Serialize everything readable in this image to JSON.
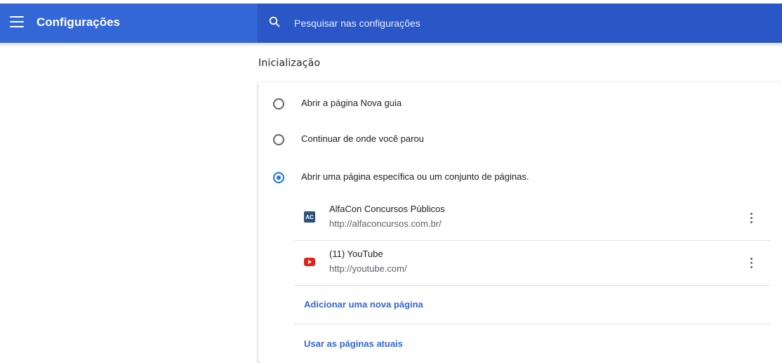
{
  "header": {
    "title": "Configurações",
    "menu_icon": "hamburger-menu-icon",
    "search_icon": "search-icon",
    "search_placeholder": "Pesquisar nas configurações",
    "search_value": "",
    "colors": {
      "toolbar": "#3367d6",
      "search_bg": "#2a56c6",
      "link": "#3367d6",
      "radio_checked": "#1a73e8"
    }
  },
  "startup": {
    "section_title": "Inicialização",
    "options": [
      {
        "label": "Abrir a página Nova guia",
        "checked": false
      },
      {
        "label": "Continuar de onde você parou",
        "checked": false
      },
      {
        "label": "Abrir uma página específica ou um conjunto de páginas.",
        "checked": true
      }
    ],
    "pages": [
      {
        "title": "AlfaCon Concursos Públicos",
        "url": "http://alfaconcursos.com.br/",
        "favicon_text": "AC",
        "favicon": "alfacon-favicon-icon"
      },
      {
        "title": "(11) YouTube",
        "url": "http://youtube.com/",
        "favicon": "youtube-favicon-icon"
      }
    ],
    "add_page_label": "Adicionar uma nova página",
    "use_current_label": "Usar as páginas atuais"
  }
}
